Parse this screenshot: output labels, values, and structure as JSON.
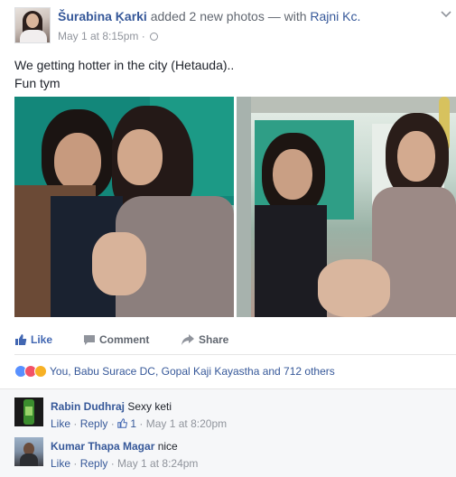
{
  "post": {
    "author": "Šurabina Ķarki",
    "action_text": " added 2 new photos — with ",
    "tagged": "Rajni Kc.",
    "timestamp": "May 1 at 8:15pm · ",
    "text_line1": "We getting hotter in the city (Hetauda)..",
    "text_line2": "Fun tym"
  },
  "actions": {
    "like": "Like",
    "comment": "Comment",
    "share": "Share"
  },
  "reactions": {
    "summary": "You, Babu Surace DC, Gopal Kaji Kayastha and 712 others",
    "types": [
      "like-icon",
      "love-icon",
      "haha-icon"
    ]
  },
  "comments": [
    {
      "author": "Rabin Dudhraj",
      "text": "Sexy keti",
      "like": "Like",
      "reply": "Reply",
      "like_count": "1",
      "time": "May 1 at 8:20pm"
    },
    {
      "author": "Kumar Thapa Magar",
      "text": "nice",
      "like": "Like",
      "reply": "Reply",
      "time": "May 1 at 8:24pm"
    }
  ],
  "colors": {
    "link": "#365899",
    "like_active": "#4267b2",
    "meta": "#90949c"
  }
}
